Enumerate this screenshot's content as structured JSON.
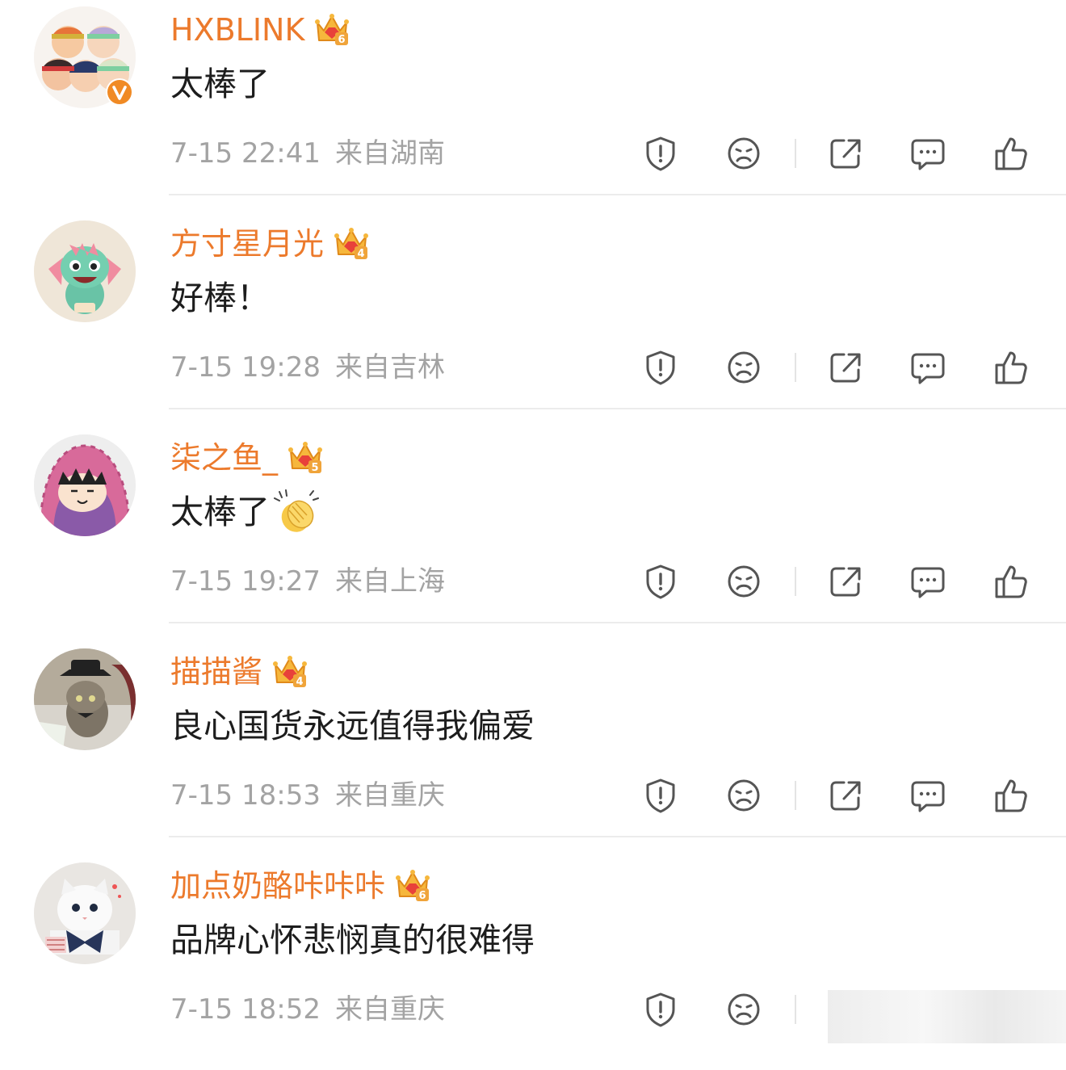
{
  "comments": [
    {
      "username": "HXBLINK",
      "level": "6",
      "verified": true,
      "text": "太棒了",
      "emoji": "",
      "time": "7-15 22:41",
      "location": "来自湖南",
      "avatar": "cartoon-group-avatar"
    },
    {
      "username": "方寸星月光",
      "level": "4",
      "verified": false,
      "text": "好棒！",
      "emoji": "",
      "time": "7-15 19:28",
      "location": "来自吉林",
      "avatar": "green-dragon-avatar"
    },
    {
      "username": "柒之鱼_",
      "level": "5",
      "verified": false,
      "text": "太棒了",
      "emoji": "clapping-hands-emoji",
      "time": "7-15 19:27",
      "location": "来自上海",
      "avatar": "hooded-cartoon-avatar"
    },
    {
      "username": "描描酱",
      "level": "4",
      "verified": false,
      "text": "良心国货永远值得我偏爱",
      "emoji": "",
      "time": "7-15 18:53",
      "location": "来自重庆",
      "avatar": "kitten-hat-avatar"
    },
    {
      "username": "加点奶酪咔咔咔",
      "level": "6",
      "verified": false,
      "text": "品牌心怀悲悯真的很难得",
      "emoji": "",
      "time": "7-15 18:52",
      "location": "来自重庆",
      "avatar": "white-cat-avatar"
    }
  ],
  "actions": [
    "report-icon",
    "dislike-icon",
    "share-icon",
    "reply-icon",
    "like-icon"
  ],
  "colors": {
    "username": "#ec7a2c",
    "text": "#1d1d1d",
    "meta": "#a3a3a3",
    "icon": "#555555",
    "divider": "#ececec",
    "crown": "#f5a623",
    "verified_badge": "#f08a24"
  }
}
